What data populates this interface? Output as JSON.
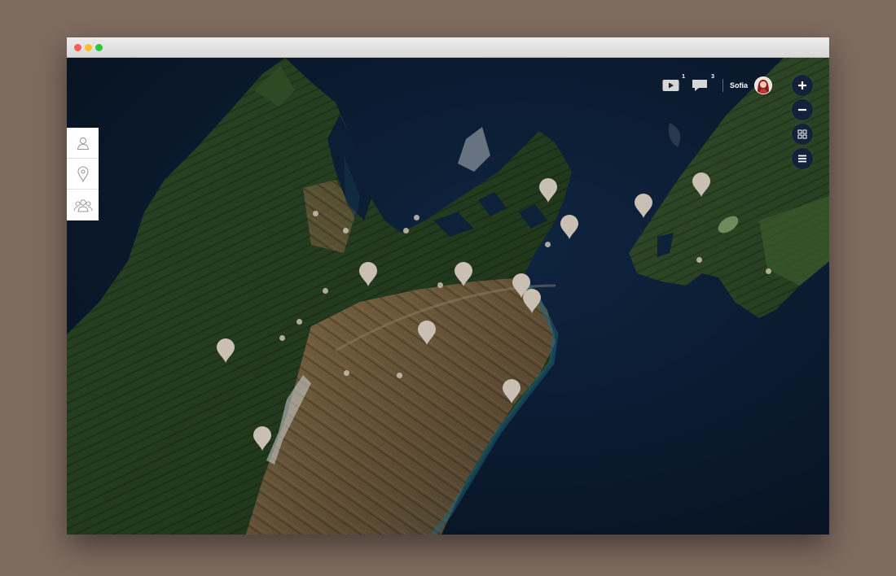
{
  "app": {
    "user": {
      "name": "Sofia"
    },
    "notifications": {
      "videos": {
        "icon": "video-icon",
        "count": "1"
      },
      "messages": {
        "icon": "chat-icon",
        "count": "3"
      }
    },
    "side_tools": [
      {
        "icon": "user-icon"
      },
      {
        "icon": "location-pin-icon"
      },
      {
        "icon": "group-icon"
      }
    ],
    "map_controls": [
      {
        "icon": "zoom-in-icon",
        "glyph": "+"
      },
      {
        "icon": "zoom-out-icon",
        "glyph": "−"
      },
      {
        "icon": "grid-icon",
        "glyph": ""
      },
      {
        "icon": "menu-icon",
        "glyph": ""
      }
    ]
  },
  "colors": {
    "sea": "#0b1a2e",
    "forest": "#1f3a1f",
    "brown_land": "#6e5a3a",
    "marker": "#c9bfb3",
    "control_bg": "#13213a"
  }
}
